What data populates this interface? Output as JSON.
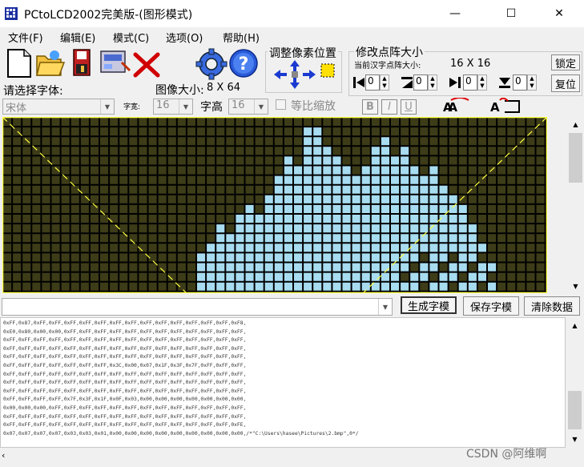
{
  "window": {
    "title": "PCtoLCD2002完美版-(图形模式)",
    "min": "—",
    "max": "☐",
    "close": "✕"
  },
  "menu": [
    "文件(F)",
    "编辑(E)",
    "模式(C)",
    "选项(O)",
    "帮助(H)"
  ],
  "toolbar": {
    "adjust_title": "调整像素位置",
    "modify_title": "修改点阵大小",
    "current_size_label": "当前汉字点阵大小:",
    "current_size_value": "16 X 16",
    "lock": "锁定",
    "reset": "复位",
    "spin_values": [
      "0",
      "0",
      "0",
      "0"
    ],
    "font_label": "请选择字体:",
    "image_size_label": "图像大小:",
    "image_size_value": "8 X 64",
    "font_value": "宋体",
    "width_label": "字宽:",
    "width_value": "16",
    "height_label": "字高",
    "height_value": "16",
    "proportional": "等比缩放",
    "bold": "B",
    "italic": "I",
    "underline": "U"
  },
  "grid": {
    "off_color": "#3d3c18",
    "on_color": "#a8dcf0",
    "line_color": "#000000",
    "diag_color": "#ffff40"
  },
  "bottom": {
    "generate": "生成字模",
    "save": "保存字模",
    "clear": "清除数据"
  },
  "output_lines": [
    "0xFF,0x87,0xFF,0xFF,0xFF,0xFF,0xFF,0xFF,0xFF,0xFF,0xFF,0xFF,0xFF,0xFF,0xFF,0xF8,",
    "0xE0,0x80,0x00,0x00,0xFF,0xFF,0xFF,0xFF,0xFF,0xFF,0xFF,0xFF,0xFF,0xFF,0xFF,0xFF,",
    "0xFF,0xFF,0xFF,0xFF,0xFF,0xFF,0xFF,0xFF,0xFF,0xFF,0xFF,0xFF,0xFF,0xFF,0xFF,0xFF,",
    "0xFF,0xFF,0xFF,0xFF,0xFF,0xFF,0xFF,0xFF,0xFF,0xFF,0xFF,0xFF,0xFF,0xFF,0xFF,0xFF,",
    "0xFF,0xFF,0xFF,0xFF,0xFF,0xFF,0xFF,0xFF,0xFF,0xFF,0xFF,0xFF,0xFF,0xFF,0xFF,0xFF,",
    "0xFF,0xFF,0xFF,0xFF,0xFF,0xFF,0xFF,0x3C,0x00,0x07,0x1F,0x3F,0x7F,0xFF,0xFF,0xFF,",
    "0xFF,0xFF,0xFF,0xFF,0xFF,0xFF,0xFF,0xFF,0xFF,0xFF,0xFF,0xFF,0xFF,0xFF,0xFF,0xFF,",
    "0xFF,0xFF,0xFF,0xFF,0xFF,0xFF,0xFF,0xFF,0xFF,0xFF,0xFF,0xFF,0xFF,0xFF,0xFF,0xFF,",
    "0xFF,0xFF,0xFF,0xFF,0xFF,0xFF,0xFF,0xFF,0xFF,0xFF,0xFF,0xFF,0xFF,0xFF,0xFF,0xFF,",
    "0xFF,0xFF,0xFF,0xFF,0x7F,0x3F,0x1F,0x0F,0x03,0x00,0x00,0x00,0x00,0x00,0x00,0x00,",
    "0x00,0x00,0x00,0xFF,0xFF,0xFF,0xFF,0xFF,0xFF,0xFF,0xFF,0xFF,0xFF,0xFF,0xFF,0xFF,",
    "0xFF,0xFF,0xFF,0xFF,0xFF,0xFF,0xFF,0xFF,0xFF,0xFF,0xFF,0xFF,0xFF,0xFF,0xFF,0xFF,",
    "0xFF,0xFF,0xFF,0xFF,0xFF,0xFF,0xFF,0xFF,0xFF,0xFF,0xFF,0xFF,0xFF,0xFF,0xFF,0xFE,",
    "0x07,0x07,0x07,0x07,0x03,0x03,0x01,0x00,0x00,0x00,0x00,0x00,0x00,0x00,0x00,0x00,/*\"C:\\Users\\hasee\\Pictures\\2.bmp\",0*/"
  ],
  "watermark": "CSDN @阿维啊"
}
